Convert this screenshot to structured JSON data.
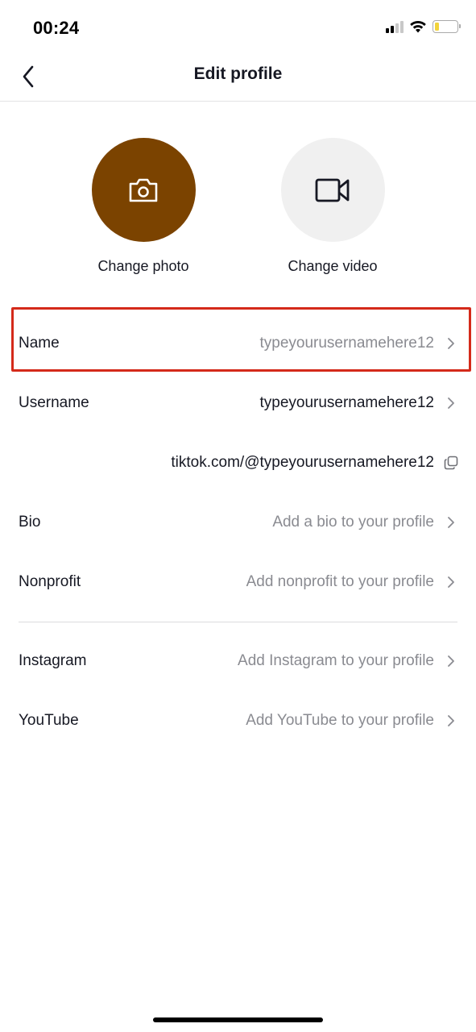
{
  "status_bar": {
    "time": "00:24",
    "signal_icon": "cellular-signal-icon",
    "wifi_icon": "wifi-icon",
    "battery_icon": "battery-low-icon",
    "battery_color": "#f2d33b"
  },
  "nav": {
    "back_icon": "chevron-left-icon",
    "title": "Edit profile"
  },
  "media": {
    "photo": {
      "label": "Change photo",
      "icon": "camera-icon",
      "color": "#7b4300"
    },
    "video": {
      "label": "Change video",
      "icon": "video-camera-icon",
      "color": "#f0f0f0"
    }
  },
  "fields": [
    {
      "label": "Name",
      "value": "typeyourusernamehere12",
      "placeholder": false,
      "highlighted": true
    },
    {
      "label": "Username",
      "value": "typeyourusernamehere12",
      "placeholder": false
    },
    {
      "label": "",
      "value": "tiktok.com/@typeyourusernamehere12",
      "action_icon": "copy-icon"
    },
    {
      "label": "Bio",
      "value": "Add a bio to your profile",
      "placeholder": true
    },
    {
      "label": "Nonprofit",
      "value": "Add nonprofit to your profile",
      "placeholder": true
    }
  ],
  "social": [
    {
      "label": "Instagram",
      "value": "Add Instagram to your profile",
      "placeholder": true
    },
    {
      "label": "YouTube",
      "value": "Add YouTube to your profile",
      "placeholder": true
    }
  ],
  "annotation": {
    "highlight_color": "#d42a1a"
  }
}
